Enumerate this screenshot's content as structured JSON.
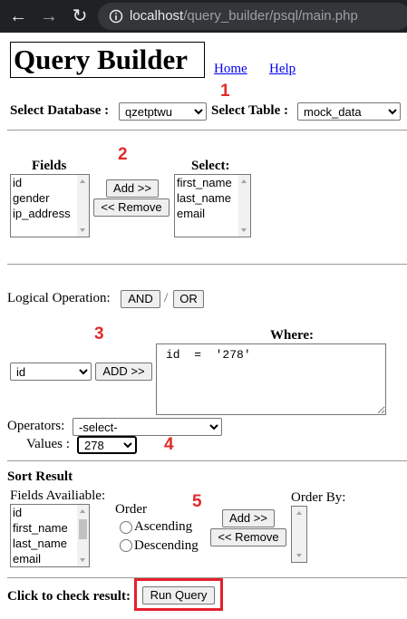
{
  "browser": {
    "url_host": "localhost",
    "url_path": "/query_builder/psql/main.php",
    "back_icon": "arrow-left",
    "forward_icon": "arrow-right",
    "reload_icon": "reload",
    "info_icon": "info-circle"
  },
  "header": {
    "title": "Query Builder",
    "links": [
      "Home",
      "Help"
    ]
  },
  "annotations": {
    "color": "#e32a2a",
    "markers": [
      "1",
      "2",
      "3",
      "4",
      "5"
    ],
    "run_highlight_color": "#e5202c"
  },
  "db_select": {
    "database_label": "Select Database :",
    "database_value": "qzetptwu",
    "table_label": "Select Table :",
    "table_value": "mock_data"
  },
  "fields": {
    "fields_label": "Fields",
    "fields_options": [
      "id",
      "gender",
      "ip_address"
    ],
    "add_label": "Add >>",
    "remove_label": "<< Remove",
    "select_label": "Select:",
    "select_options": [
      "first_name",
      "last_name",
      "email"
    ]
  },
  "logical": {
    "label": "Logical Operation:",
    "and_label": "AND",
    "separator": "/",
    "or_label": "OR"
  },
  "where": {
    "field_value": "id",
    "add_label": "ADD >>",
    "where_label": "Where:",
    "where_text": "id  =  '278'",
    "operators_label": "Operators:",
    "operators_value": "-select-",
    "values_label": "Values :",
    "values_value": "278"
  },
  "sort": {
    "heading": "Sort Result",
    "fields_available_label": "Fields Availiable:",
    "fields_available_options": [
      "id",
      "first_name",
      "last_name",
      "email"
    ],
    "order_label": "Order",
    "ascending_label": "Ascending",
    "descending_label": "Descending",
    "add_label": "Add >>",
    "remove_label": "<< Remove",
    "order_by_label": "Order By:"
  },
  "run": {
    "label": "Click to check result:",
    "button_label": "Run Query"
  }
}
